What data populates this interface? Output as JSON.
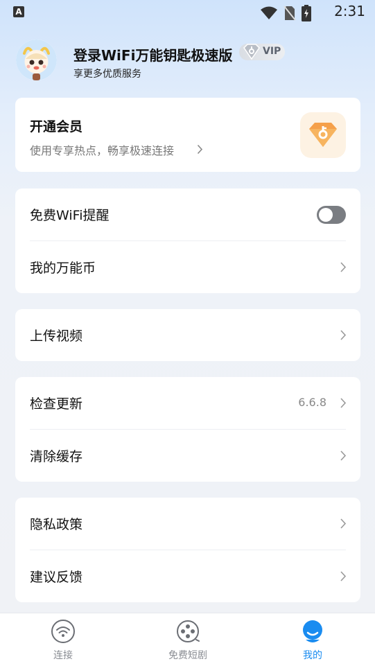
{
  "status_bar": {
    "time": "2:31",
    "notification_letter": "A"
  },
  "profile": {
    "name": "登录WiFi万能钥匙极速版",
    "vip_badge": "VIP",
    "subtitle": "享更多优质服务"
  },
  "member_card": {
    "title": "开通会员",
    "subtitle": "使用专享热点，畅享极速连接"
  },
  "sections": {
    "s1": {
      "wifi_reminder": "免费WiFi提醒",
      "wifi_reminder_enabled": false,
      "coins": "我的万能币"
    },
    "s2": {
      "upload_video": "上传视频"
    },
    "s3": {
      "check_update": "检查更新",
      "version": "6.6.8",
      "clear_cache": "清除缓存"
    },
    "s4": {
      "privacy": "隐私政策",
      "feedback": "建议反馈"
    }
  },
  "bottom_nav": {
    "connect": "连接",
    "dramas": "免费短剧",
    "mine": "我的",
    "active": "mine"
  },
  "colors": {
    "accent": "#1a8cf0",
    "member_orange": "#f5a04a",
    "toggle_off": "#7a7d82"
  }
}
